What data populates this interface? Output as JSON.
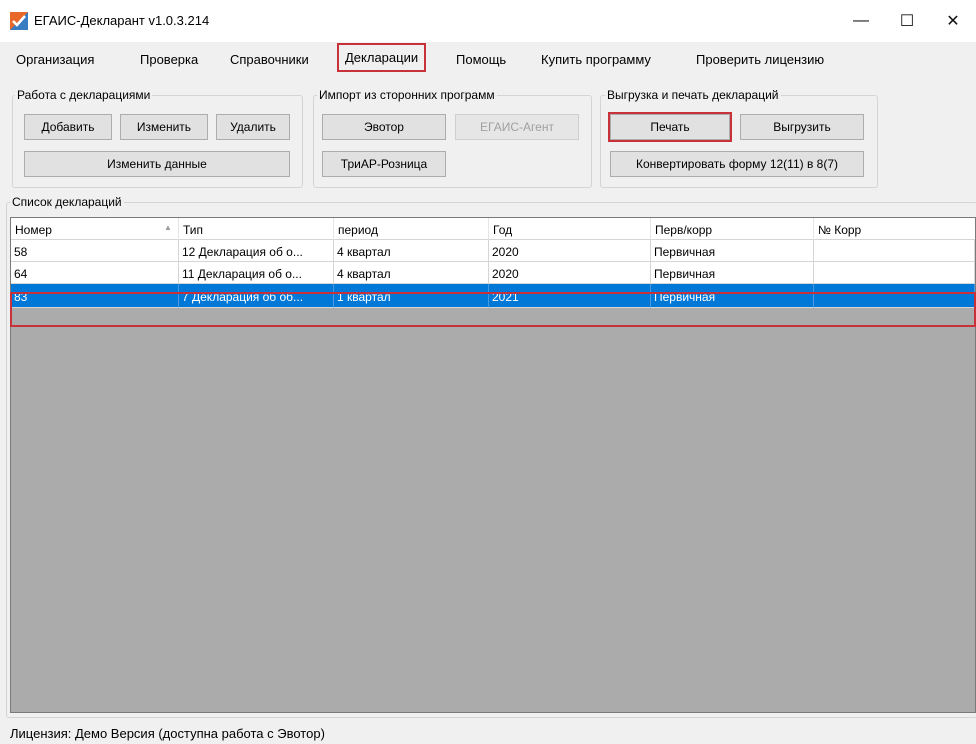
{
  "window": {
    "title": "ЕГАИС-Декларант v1.0.3.214",
    "controls": {
      "minimize": "—",
      "maximize": "☐",
      "close": "✕"
    }
  },
  "menu": [
    "Организация",
    "Проверка",
    "Справочники",
    "Декларации",
    "Помощь",
    "Купить программу",
    "Проверить лицензию"
  ],
  "groups": {
    "work": {
      "title": "Работа с декларациями",
      "add": "Добавить",
      "edit": "Изменить",
      "delete": "Удалить",
      "edit_data": "Изменить данные"
    },
    "import": {
      "title": "Импорт из сторонних программ",
      "evotor": "Эвотор",
      "egais_agent": "ЕГАИС-Агент",
      "triar": "ТриАР-Розница"
    },
    "export": {
      "title": "Выгрузка и печать деклараций",
      "print": "Печать",
      "export": "Выгрузить",
      "convert": "Конвертировать форму 12(11) в 8(7)"
    }
  },
  "list": {
    "title": "Список деклараций",
    "columns": [
      "Номер",
      "Тип",
      "период",
      "Год",
      "Перв/корр",
      "№ Корр"
    ],
    "rows": [
      [
        "58",
        "12 Декларация об о...",
        "4 квартал",
        "2020",
        "Первичная",
        ""
      ],
      [
        "64",
        "11 Декларация об о...",
        "4 квартал",
        "2020",
        "Первичная",
        ""
      ],
      [
        "83",
        "7 Декларация об об...",
        "1 квартал",
        "2021",
        "Первичная",
        ""
      ]
    ],
    "selected_row": 2
  },
  "status": "Лицензия: Демо Версия (доступна работа с Эвотор)",
  "colors": {
    "highlight": "#c8303a",
    "selection": "#0078d7"
  }
}
